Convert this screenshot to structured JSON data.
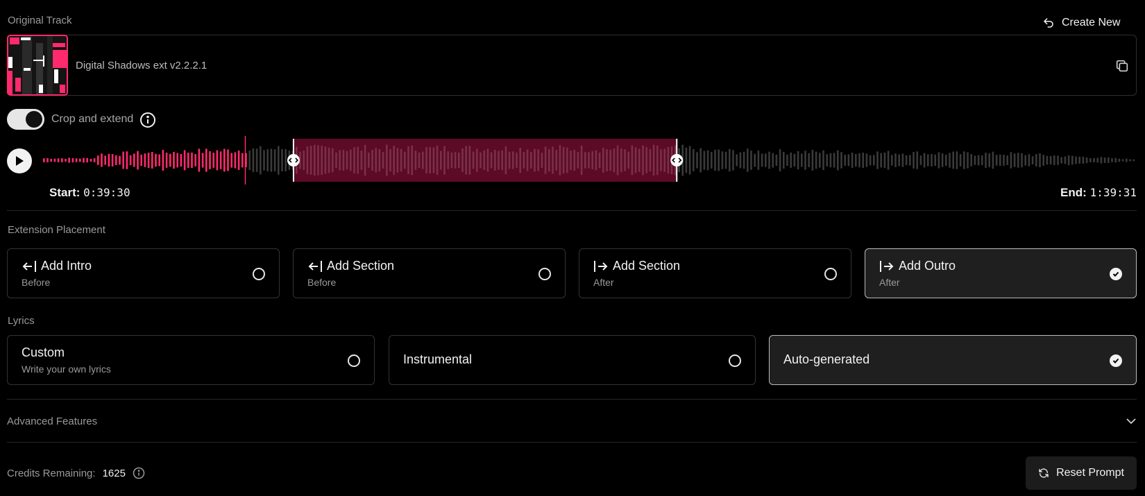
{
  "header": {
    "section_label": "Original Track",
    "create_new_label": "Create New"
  },
  "track": {
    "title": "Digital Shadows ext v2.2.2.1"
  },
  "crop": {
    "toggle_label": "Crop and extend",
    "enabled": true
  },
  "waveform": {
    "start_label": "Start:",
    "start_time": "0:39:30",
    "end_label": "End:",
    "end_time": "1:39:31",
    "played_fraction": 0.186,
    "selection_start_fraction": 0.23,
    "selection_end_fraction": 0.58
  },
  "placement": {
    "label": "Extension Placement",
    "options": [
      {
        "title": "Add Intro",
        "sub": "Before",
        "selected": false
      },
      {
        "title": "Add Section",
        "sub": "Before",
        "selected": false
      },
      {
        "title": "Add Section",
        "sub": "After",
        "selected": false
      },
      {
        "title": "Add Outro",
        "sub": "After",
        "selected": true
      }
    ]
  },
  "lyrics": {
    "label": "Lyrics",
    "options": [
      {
        "title": "Custom",
        "sub": "Write your own lyrics",
        "selected": false
      },
      {
        "title": "Instrumental",
        "selected": false
      },
      {
        "title": "Auto-generated",
        "selected": true
      }
    ]
  },
  "advanced": {
    "label": "Advanced Features"
  },
  "footer": {
    "credits_label": "Credits Remaining:",
    "credits_value": "1625",
    "reset_label": "Reset Prompt"
  },
  "colors": {
    "accent": "#ff2a6d",
    "selection": "#5c0a26"
  }
}
